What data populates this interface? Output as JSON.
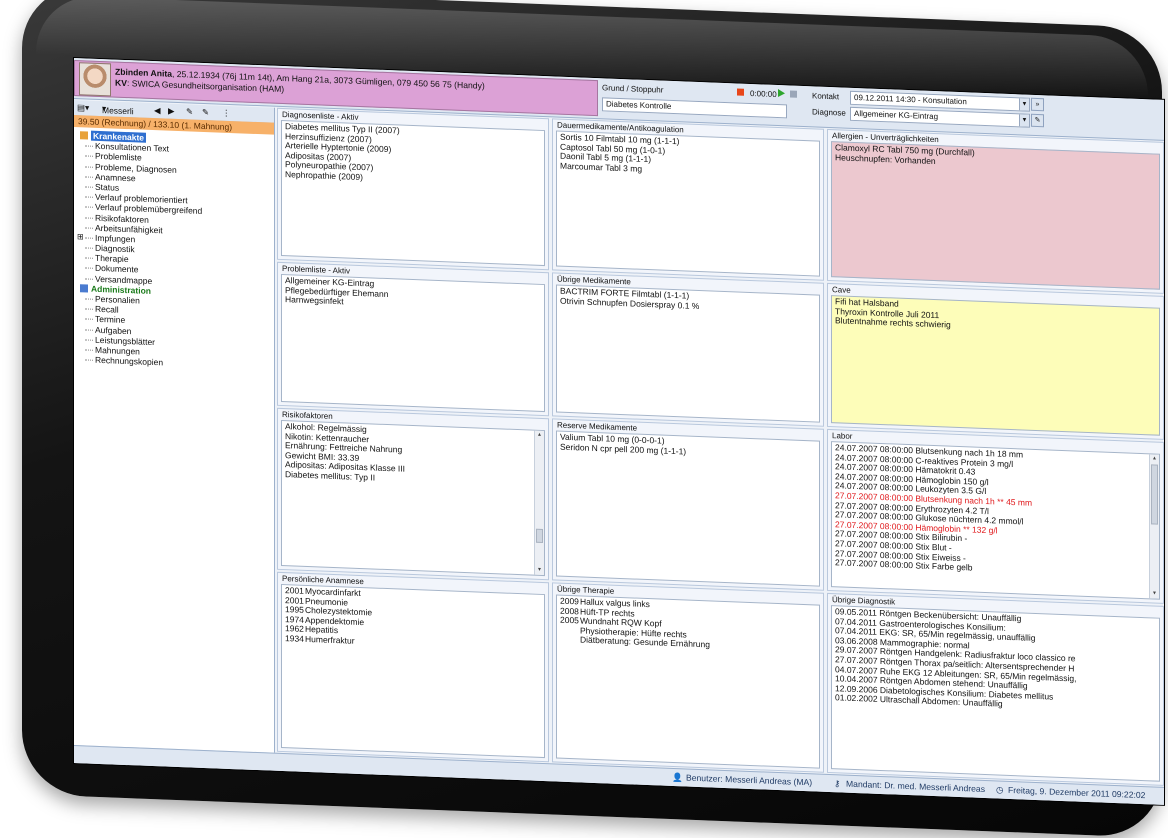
{
  "header": {
    "patient_name": "Zbinden Anita",
    "patient_details": ", 25.12.1934 (76j 11m 14t), Am Hang 21a, 3073 Gümligen, 079 450 56 75 (Handy)",
    "kv_label": "KV",
    "kv_value": ": SWICA Gesundheitsorganisation (HAM)",
    "grund_label": "Grund / Stoppuhr",
    "grund_value": "Diabetes Kontrolle",
    "timer": "0:00:00",
    "kontakt_label": "Kontakt",
    "kontakt_value": "09.12.2011 14:30 - Konsultation",
    "diagnose_label": "Diagnose",
    "diagnose_value": "Allgemeiner KG-Eintrag"
  },
  "sidebar": {
    "user_label": "Messerli",
    "account": "39.50 (Rechnung) / 133.10 (1. Mahnung)",
    "items": [
      {
        "label": "Krankenakte",
        "type": "header-selected"
      },
      {
        "label": "Konsultationen Text",
        "type": "child"
      },
      {
        "label": "Problemliste",
        "type": "child"
      },
      {
        "label": "Probleme, Diagnosen",
        "type": "child"
      },
      {
        "label": "Anamnese",
        "type": "child"
      },
      {
        "label": "Status",
        "type": "child"
      },
      {
        "label": "Verlauf problemorientiert",
        "type": "child"
      },
      {
        "label": "Verlauf problemübergreifend",
        "type": "child"
      },
      {
        "label": "Risikofaktoren",
        "type": "child"
      },
      {
        "label": "Arbeitsunfähigkeit",
        "type": "child"
      },
      {
        "label": "Impfungen",
        "type": "child-expand"
      },
      {
        "label": "Diagnostik",
        "type": "child"
      },
      {
        "label": "Therapie",
        "type": "child"
      },
      {
        "label": "Dokumente",
        "type": "child"
      },
      {
        "label": "Versandmappe",
        "type": "child"
      },
      {
        "label": "Administration",
        "type": "header-admin"
      },
      {
        "label": "Personalien",
        "type": "child"
      },
      {
        "label": "Recall",
        "type": "child"
      },
      {
        "label": "Termine",
        "type": "child"
      },
      {
        "label": "Aufgaben",
        "type": "child"
      },
      {
        "label": "Leistungsblätter",
        "type": "child"
      },
      {
        "label": "Mahnungen",
        "type": "child"
      },
      {
        "label": "Rechnungskopien",
        "type": "child"
      }
    ]
  },
  "panels": {
    "diagnosen": {
      "title": "Diagnosenliste - Aktiv",
      "lines": [
        "Diabetes mellitus Typ II (2007)",
        "Herzinsuffizienz (2007)",
        "Arterielle Hyptertonie (2009)",
        "Adipositas  (2007)",
        "Polyneuropathie (2007)",
        "Nephropathie (2009)"
      ]
    },
    "dauermedi": {
      "title": "Dauermedikamente/Antikoagulation",
      "lines": [
        "Sortis 10 Filmtabl 10 mg (1-1-1)",
        "Captosol Tabl 50 mg (1-0-1)",
        "Daonil Tabl 5 mg (1-1-1)",
        "Marcoumar Tabl 3 mg"
      ]
    },
    "allergien": {
      "title": "Allergien - Unverträglichkeiten",
      "lines": [
        "Clamoxyl RC Tabl 750 mg (Durchfall)",
        "Heuschnupfen: Vorhanden"
      ]
    },
    "probleme": {
      "title": "Problemliste - Aktiv",
      "lines": [
        "Allgemeiner KG-Eintrag",
        "Pflegebedürftiger Ehemann",
        "Harnwegsinfekt"
      ]
    },
    "uebrige_medi": {
      "title": "Übrige Medikamente",
      "lines": [
        "BACTRIM FORTE Filmtabl (1-1-1)",
        "Otrivin Schnupfen Dosierspray 0.1 %"
      ]
    },
    "cave": {
      "title": "Cave",
      "lines": [
        "Fifi hat Halsband",
        "Thyroxin Kontrolle Juli 2011",
        "Blutentnahme rechts schwierig"
      ]
    },
    "risiko": {
      "title": "Risikofaktoren",
      "lines": [
        "Alkohol: Regelmässig",
        "Nikotin: Kettenraucher",
        "Ernährung: Fettreiche Nahrung",
        "Gewicht BMI: 33.39",
        "Adipositas: Adipositas Klasse III",
        "Diabetes mellitus: Typ II"
      ]
    },
    "reserve": {
      "title": "Reserve Medikamente",
      "lines": [
        "Valium Tabl 10 mg (0-0-0-1)",
        "Seridon N  cpr pell 200 mg (1-1-1)"
      ]
    },
    "labor": {
      "title": "Labor",
      "lines": [
        {
          "text": "24.07.2007 08:00:00  Blutsenkung nach 1h  18 mm",
          "flag": false
        },
        {
          "text": "24.07.2007 08:00:00  C-reaktives Protein  3 mg/l",
          "flag": false
        },
        {
          "text": "24.07.2007 08:00:00  Hämatokrit  0.43",
          "flag": false
        },
        {
          "text": "24.07.2007 08:00:00  Hämoglobin  150 g/l",
          "flag": false
        },
        {
          "text": "24.07.2007 08:00:00  Leukozyten  3.5 G/l",
          "flag": false
        },
        {
          "text": "27.07.2007 08:00:00  Blutsenkung nach 1h  ** 45 mm",
          "flag": true
        },
        {
          "text": "27.07.2007 08:00:00  Erythrozyten  4.2 T/l",
          "flag": false
        },
        {
          "text": "27.07.2007 08:00:00  Glukose nüchtern  4.2 mmol/l",
          "flag": false
        },
        {
          "text": "27.07.2007 08:00:00  Hämoglobin  ** 132 g/l",
          "flag": true
        },
        {
          "text": "27.07.2007 08:00:00  Stix Bilirubin  -",
          "flag": false
        },
        {
          "text": "27.07.2007 08:00:00  Stix Blut  -",
          "flag": false
        },
        {
          "text": "27.07.2007 08:00:00  Stix Eiweiss  -",
          "flag": false
        },
        {
          "text": "27.07.2007 08:00:00  Stix Farbe  gelb",
          "flag": false
        }
      ]
    },
    "anamnese": {
      "title": "Persönliche Anamnese",
      "lines": [
        {
          "year": "2001",
          "text": "Myocardinfarkt"
        },
        {
          "year": "2001",
          "text": "Pneumonie"
        },
        {
          "year": "1995",
          "text": "Cholezystektomie"
        },
        {
          "year": "1974",
          "text": "Appendektomie"
        },
        {
          "year": "1962",
          "text": "Hepatitis"
        },
        {
          "year": "1934",
          "text": "Humerfraktur"
        }
      ]
    },
    "therapie": {
      "title": "Übrige Therapie",
      "lines": [
        {
          "year": "2009",
          "text": "Hallux valgus links"
        },
        {
          "year": "2008",
          "text": "Hüft-TP rechts"
        },
        {
          "year": "2005",
          "text": "Wundnaht RQW Kopf"
        },
        {
          "year": "",
          "text": "Physiotherapie: Hüfte rechts"
        },
        {
          "year": "",
          "text": "Diätberatung: Gesunde Ernährung"
        }
      ]
    },
    "diagnostik": {
      "title": "Übrige Diagnostik",
      "lines": [
        "09.05.2011 Röntgen Beckenübersicht: Unauffällig",
        "07.04.2011 Gastroenterologisches Konsilium:",
        "07.04.2011 EKG: SR, 65/Min regelmässig, unauffällig",
        "03.06.2008 Mammographie: normal",
        "29.07.2007 Röntgen Handgelenk: Radiusfraktur loco classico re",
        "27.07.2007 Röntgen Thorax pa/seitlich: Altersentsprechender H",
        "04.07.2007 Ruhe EKG 12 Ableitungen: SR, 65/Min regelmässig,",
        "10.04.2007 Röntgen Abdomen stehend: Unauffällig",
        "12.09.2006 Diabetologisches Konsilium: Diabetes mellitus",
        "01.02.2002 Ultraschall Abdomen: Unauffällig"
      ]
    }
  },
  "status": {
    "user": "Benutzer: Messerli Andreas  (MA)",
    "mandant": "Mandant: Dr. med. Messerli Andreas",
    "date": "Freitag, 9. Dezember 2011 09:22:02"
  },
  "colors": {
    "patient_bar": "#dca1d6",
    "account_bar": "#f7b169",
    "allergy_bg": "#ecc8cf",
    "cave_bg": "#fdfdb9",
    "lab_flag": "#e0181b"
  }
}
